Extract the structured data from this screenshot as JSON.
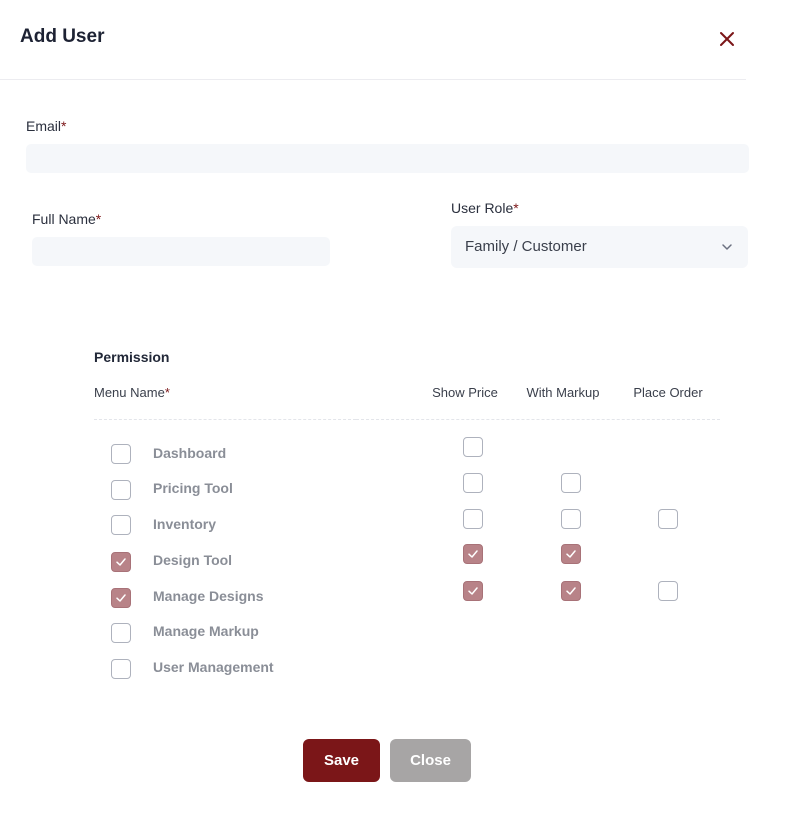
{
  "modal": {
    "title": "Add User"
  },
  "form": {
    "email_label": "Email",
    "email_value": "",
    "full_name_label": "Full Name",
    "full_name_value": "",
    "user_role_label": "User Role",
    "user_role_value": "Family / Customer",
    "required_mark": "*"
  },
  "permissions": {
    "title": "Permission",
    "menu_name_label": "Menu Name",
    "show_price_label": "Show Price",
    "with_markup_label": "With Markup",
    "place_order_label": "Place Order",
    "rows": [
      {
        "label": "Dashboard",
        "menu": false,
        "show_price": false
      },
      {
        "label": "Pricing Tool",
        "menu": false,
        "show_price": false,
        "with_markup": false
      },
      {
        "label": "Inventory",
        "menu": false,
        "show_price": false,
        "with_markup": false,
        "place_order": false
      },
      {
        "label": "Design Tool",
        "menu": true,
        "show_price": true,
        "with_markup": true
      },
      {
        "label": "Manage Designs",
        "menu": true,
        "show_price": true,
        "with_markup": true,
        "place_order": false
      },
      {
        "label": "Manage Markup",
        "menu": false
      },
      {
        "label": "User Management",
        "menu": false
      }
    ]
  },
  "actions": {
    "save_label": "Save",
    "close_label": "Close"
  },
  "colors": {
    "accent": "#7b1618",
    "checked_fill": "#b88388",
    "close_button": "#a7a5a5"
  }
}
